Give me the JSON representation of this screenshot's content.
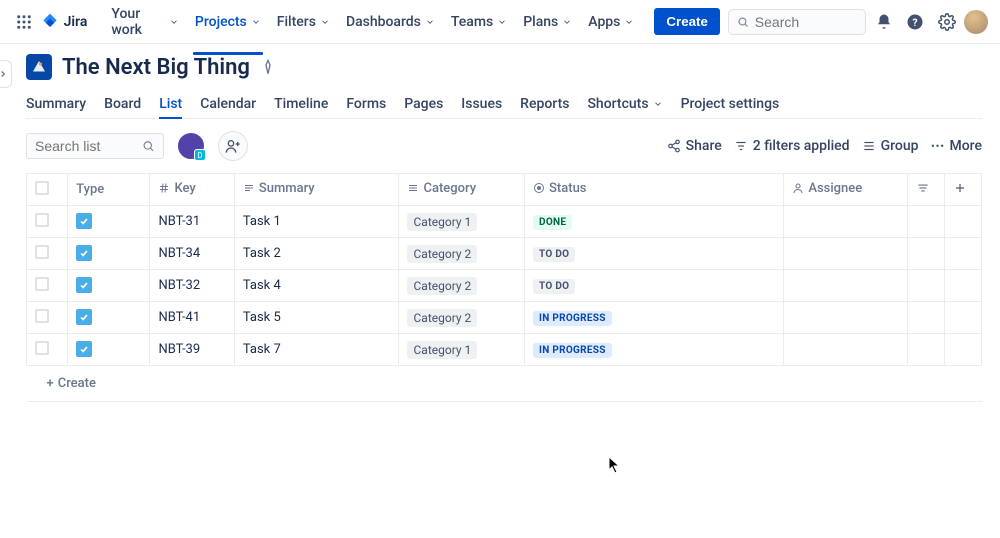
{
  "nav": {
    "product": "Jira",
    "items": [
      "Your work",
      "Projects",
      "Filters",
      "Dashboards",
      "Teams",
      "Plans",
      "Apps"
    ],
    "active_index": 1,
    "create": "Create",
    "search_placeholder": "Search"
  },
  "project": {
    "name": "The Next Big Thing",
    "tabs": [
      "Summary",
      "Board",
      "List",
      "Calendar",
      "Timeline",
      "Forms",
      "Pages",
      "Issues",
      "Reports",
      "Shortcuts",
      "Project settings"
    ],
    "active_tab_index": 2,
    "shortcuts_has_chevron": true
  },
  "toolbar": {
    "search_placeholder": "Search list",
    "share": "Share",
    "filters_applied": "2 filters applied",
    "group": "Group",
    "more": "More"
  },
  "columns": {
    "type": "Type",
    "key": "Key",
    "summary": "Summary",
    "category": "Category",
    "status": "Status",
    "assignee": "Assignee"
  },
  "rows": [
    {
      "key": "NBT-31",
      "summary": "Task 1",
      "category": "Category 1",
      "status": "DONE",
      "status_kind": "done"
    },
    {
      "key": "NBT-34",
      "summary": "Task 2",
      "category": "Category 2",
      "status": "TO DO",
      "status_kind": "todo"
    },
    {
      "key": "NBT-32",
      "summary": "Task 4",
      "category": "Category 2",
      "status": "TO DO",
      "status_kind": "todo"
    },
    {
      "key": "NBT-41",
      "summary": "Task 5",
      "category": "Category 2",
      "status": "IN PROGRESS",
      "status_kind": "inprog"
    },
    {
      "key": "NBT-39",
      "summary": "Task 7",
      "category": "Category 1",
      "status": "IN PROGRESS",
      "status_kind": "inprog"
    }
  ],
  "create_row": "Create",
  "avatar_badge_letter": "D"
}
